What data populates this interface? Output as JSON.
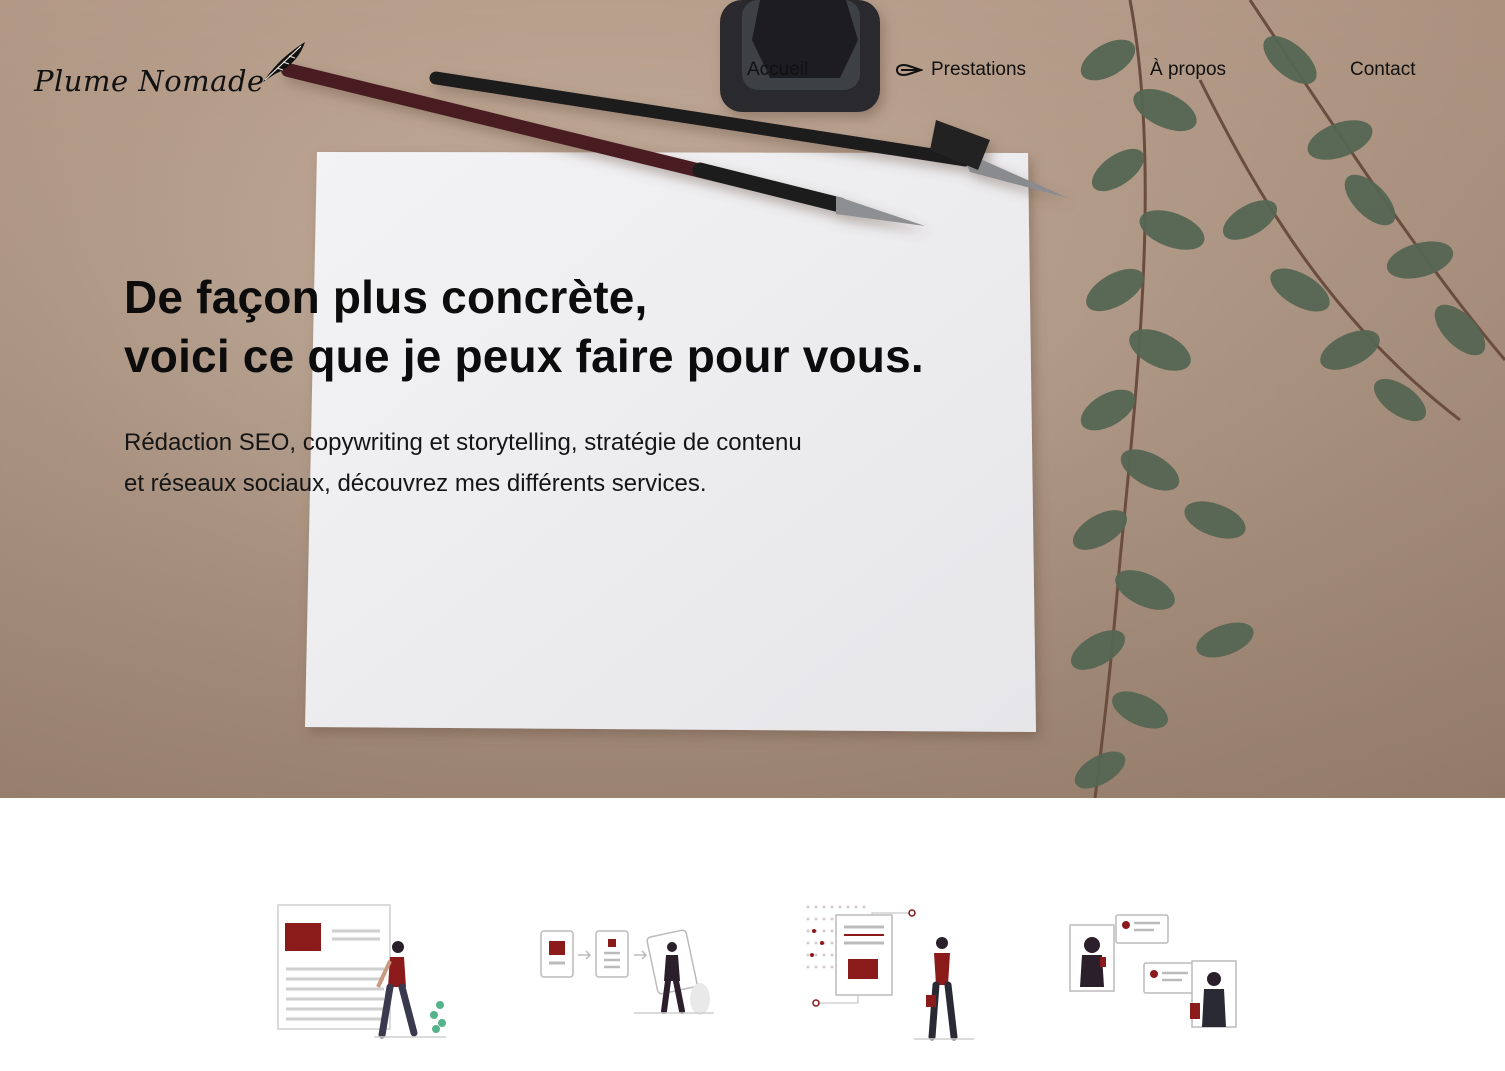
{
  "header": {
    "logo_text": "Plume Nomade",
    "logo_icon": "feather-icon",
    "nav": [
      {
        "label": "Accueil",
        "active": false
      },
      {
        "label": "Prestations",
        "active": true,
        "icon": "pen-icon"
      },
      {
        "label": "À propos",
        "active": false
      },
      {
        "label": "Contact",
        "active": false
      }
    ]
  },
  "hero": {
    "title_line1": "De façon plus concrète,",
    "title_line2": "voici ce que je peux faire pour vous.",
    "subtitle_line1": "Rédaction SEO, copywriting et storytelling, stratégie de contenu",
    "subtitle_line2": "et réseaux sociaux, découvrez mes différents services.",
    "background": "desk with fountain pens, ink bottle, blank paper and eucalyptus"
  },
  "services_illustrations": [
    {
      "name": "seo-writing-illustration"
    },
    {
      "name": "copywriting-workflow-illustration"
    },
    {
      "name": "content-strategy-illustration"
    },
    {
      "name": "social-media-chat-illustration"
    }
  ],
  "colors": {
    "accent": "#8b1a1a",
    "text": "#111111",
    "hero_bg": "#b9a08d",
    "paper": "#f1f1f2",
    "leaf": "#4d5b4c"
  }
}
